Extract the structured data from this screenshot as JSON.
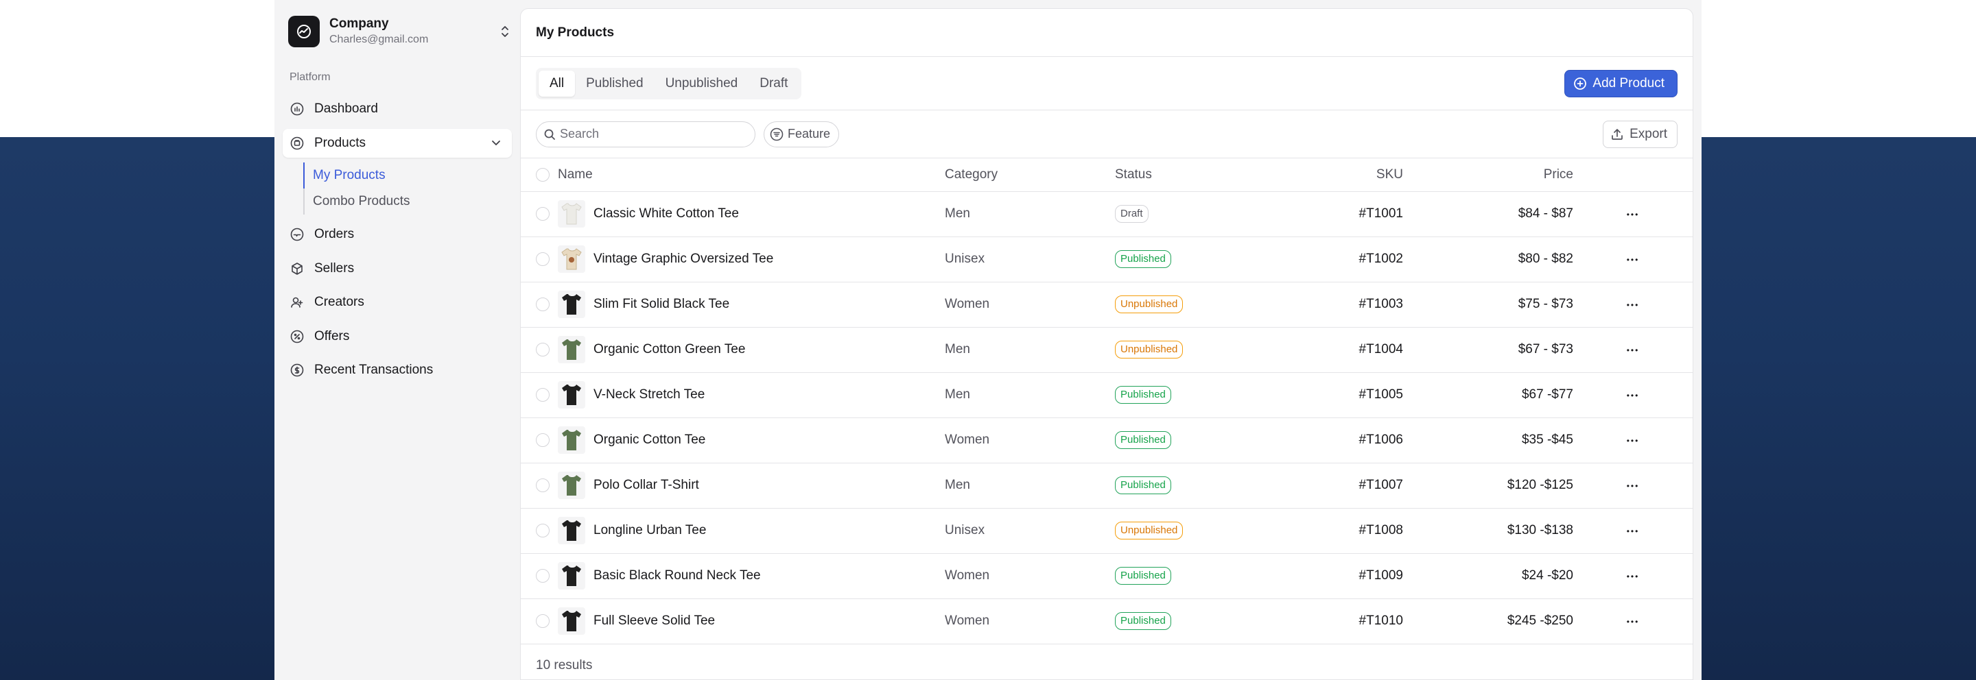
{
  "company": {
    "name": "Company",
    "email": "Charles@gmail.com"
  },
  "sidebar": {
    "section_label": "Platform",
    "items": [
      {
        "label": "Dashboard",
        "icon": "dashboard-icon"
      },
      {
        "label": "Products",
        "icon": "products-icon"
      },
      {
        "label": "Orders",
        "icon": "orders-icon"
      },
      {
        "label": "Sellers",
        "icon": "sellers-icon"
      },
      {
        "label": "Creators",
        "icon": "creators-icon"
      },
      {
        "label": "Offers",
        "icon": "offers-icon"
      },
      {
        "label": "Recent Transactions",
        "icon": "transactions-icon"
      }
    ],
    "sub_items": [
      {
        "label": "My Products"
      },
      {
        "label": "Combo Products"
      }
    ]
  },
  "main": {
    "title": "My Products",
    "tabs": [
      {
        "label": "All"
      },
      {
        "label": "Published"
      },
      {
        "label": "Unpublished"
      },
      {
        "label": "Draft"
      }
    ],
    "add_button": "Add Product",
    "search_placeholder": "Search",
    "feature_chip": "Feature",
    "export_button": "Export",
    "columns": {
      "name": "Name",
      "category": "Category",
      "status": "Status",
      "sku": "SKU",
      "price": "Price"
    },
    "rows": [
      {
        "name": "Classic White Cotton Tee",
        "category": "Men",
        "status": "Draft",
        "sku": "#T1001",
        "price": "$84 - $87",
        "thumb": "white"
      },
      {
        "name": "Vintage Graphic Oversized Tee",
        "category": "Unisex",
        "status": "Published",
        "sku": "#T1002",
        "price": "$80 - $82",
        "thumb": "graphic"
      },
      {
        "name": "Slim Fit Solid Black Tee",
        "category": "Women",
        "status": "Unpublished",
        "sku": "#T1003",
        "price": "$75 - $73",
        "thumb": "black"
      },
      {
        "name": "Organic Cotton Green Tee",
        "category": "Men",
        "status": "Unpublished",
        "sku": "#T1004",
        "price": "$67 - $73",
        "thumb": "green"
      },
      {
        "name": "V-Neck Stretch Tee",
        "category": "Men",
        "status": "Published",
        "sku": "#T1005",
        "price": "$67 -$77",
        "thumb": "black"
      },
      {
        "name": "Organic Cotton Tee",
        "category": "Women",
        "status": "Published",
        "sku": "#T1006",
        "price": "$35 -$45",
        "thumb": "green"
      },
      {
        "name": "Polo Collar T-Shirt",
        "category": "Men",
        "status": "Published",
        "sku": "#T1007",
        "price": "$120 -$125",
        "thumb": "green"
      },
      {
        "name": "Longline Urban Tee",
        "category": "Unisex",
        "status": "Unpublished",
        "sku": "#T1008",
        "price": "$130 -$138",
        "thumb": "black"
      },
      {
        "name": "Basic Black Round Neck Tee",
        "category": "Women",
        "status": "Published",
        "sku": "#T1009",
        "price": "$24 -$20",
        "thumb": "black"
      },
      {
        "name": "Full Sleeve Solid Tee",
        "category": "Women",
        "status": "Published",
        "sku": "#T1010",
        "price": "$245 -$250",
        "thumb": "black"
      }
    ],
    "results_text": "10 results"
  },
  "colors": {
    "accent": "#3b63d9",
    "published": "#16a34a",
    "unpublished": "#d97706",
    "navy": "#1a3560"
  }
}
